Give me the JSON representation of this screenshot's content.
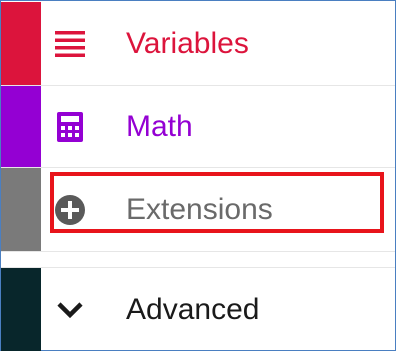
{
  "categories": [
    {
      "label": "Variables",
      "icon": "list-icon",
      "color": "#dc143c",
      "bar": "#dc143c"
    },
    {
      "label": "Math",
      "icon": "calculator-icon",
      "color": "#9400d3",
      "bar": "#9400d3"
    },
    {
      "label": "Extensions",
      "icon": "add-circle-icon",
      "color": "#6a6a6a",
      "bar": "#7a7a7a"
    },
    {
      "label": "Advanced",
      "icon": "chevron-down-icon",
      "color": "#1a1a1a",
      "bar": "#08262b"
    }
  ],
  "highlight_color": "#e8141b"
}
